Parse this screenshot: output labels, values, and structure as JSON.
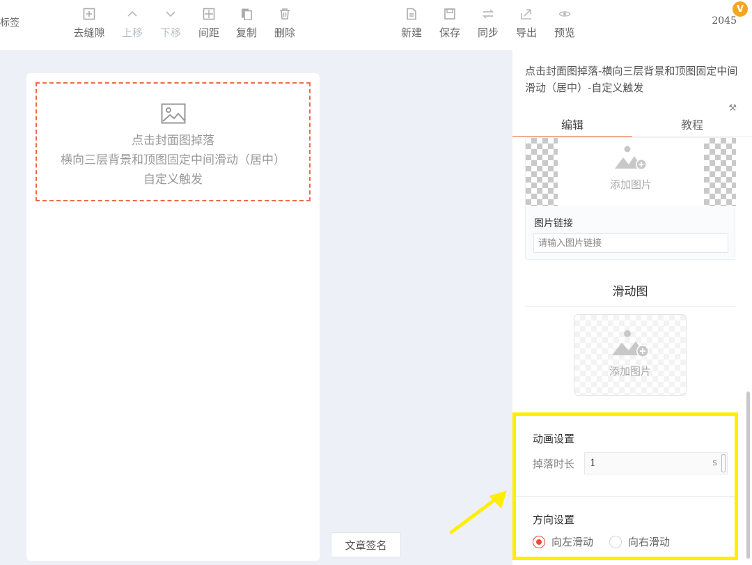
{
  "toolbar": {
    "left_label": "标签",
    "buttons": [
      {
        "label": "去缝隙",
        "icon": "plus-square-icon",
        "disabled": false
      },
      {
        "label": "上移",
        "icon": "chevron-up-icon",
        "disabled": true
      },
      {
        "label": "下移",
        "icon": "chevron-down-icon",
        "disabled": true
      },
      {
        "label": "间距",
        "icon": "spacing-icon",
        "disabled": false
      },
      {
        "label": "复制",
        "icon": "copy-icon",
        "disabled": false
      },
      {
        "label": "删除",
        "icon": "trash-icon",
        "disabled": false
      },
      {
        "label": "新建",
        "icon": "new-file-icon",
        "disabled": false
      },
      {
        "label": "保存",
        "icon": "save-icon",
        "disabled": false
      },
      {
        "label": "同步",
        "icon": "sync-icon",
        "disabled": false
      },
      {
        "label": "导出",
        "icon": "export-icon",
        "disabled": false
      },
      {
        "label": "预览",
        "icon": "eye-icon",
        "disabled": false
      }
    ],
    "count": "2045",
    "vip_badge": "V"
  },
  "article": {
    "cover_lines": [
      "点击封面图掉落",
      "横向三层背景和顶图固定中间滑动（居中）",
      "自定义触发"
    ],
    "signature_button": "文章签名"
  },
  "panel": {
    "title": "点击封面图掉落-横向三层背景和顶图固定中间滑动（居中）-自定义触发",
    "tabs": [
      "编辑",
      "教程"
    ],
    "active_tab": "编辑",
    "image_card": {
      "add_image_label": "添加图片",
      "link_label": "图片链接",
      "link_placeholder": "请输入图片链接"
    },
    "slide_section": {
      "title": "滑动图",
      "add_image_label": "添加图片"
    },
    "animation": {
      "title": "动画设置",
      "duration_label": "掉落时长",
      "duration_value": "1",
      "duration_unit": "s"
    },
    "direction": {
      "title": "方向设置",
      "options": [
        "向左滑动",
        "向右滑动"
      ],
      "selected": "向左滑动"
    }
  },
  "colors": {
    "accent": "#ef4a3a",
    "dashed_border": "#ef6a4a",
    "highlight": "#ffee00",
    "background": "#eef0f8"
  }
}
